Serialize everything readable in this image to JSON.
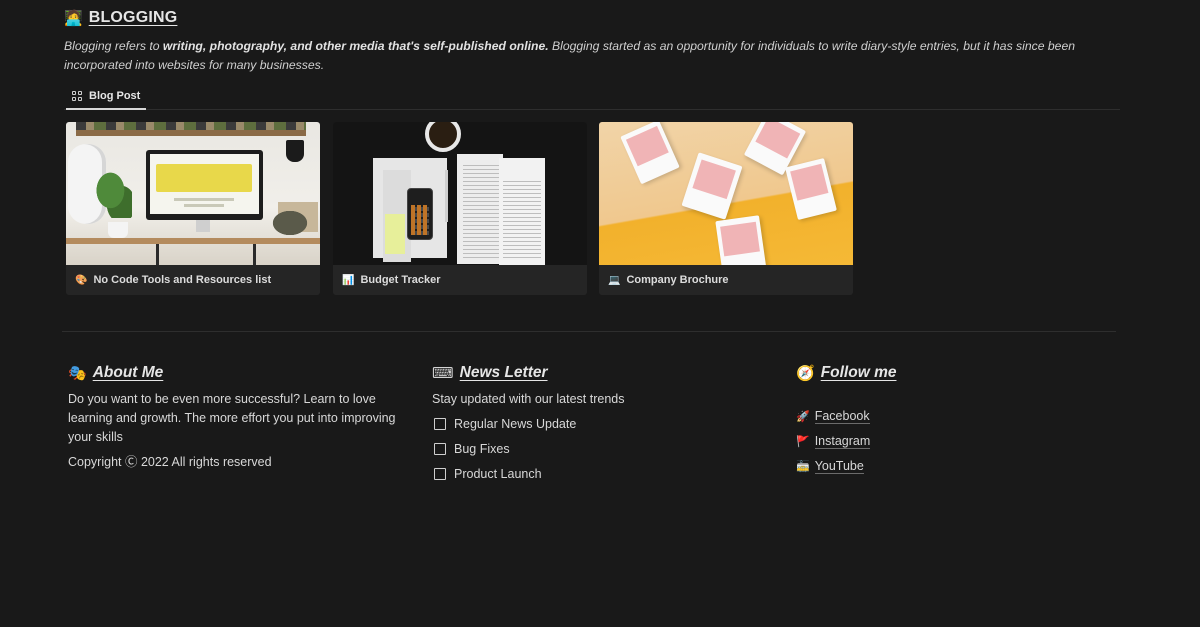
{
  "header": {
    "icon": "technologist-emoji-icon",
    "icon_glyph": "🧑‍💻",
    "title": "BLOGGING",
    "desc_pre": "Blogging refers to ",
    "desc_bold": "writing, photography, and other media that's self-published online.",
    "desc_post": " Blogging started as an opportunity for individuals to write diary-style entries, but it has since been incorporated into websites for many businesses."
  },
  "tabs": [
    {
      "label": "Blog Post",
      "icon": "gallery-grid-icon",
      "active": true
    }
  ],
  "cards": [
    {
      "title": "No Code Tools and Resources list",
      "icon": "palette-icon",
      "icon_glyph": "🎨",
      "image": "desk-with-monitor-and-plants"
    },
    {
      "title": "Budget Tracker",
      "icon": "bar-chart-icon",
      "icon_glyph": "📊",
      "image": "tax-forms-and-calculator"
    },
    {
      "title": "Company Brochure",
      "icon": "laptop-icon",
      "icon_glyph": "💻",
      "image": "floating-pink-brochures"
    }
  ],
  "about": {
    "icon": "performing-arts-icon",
    "icon_glyph": "🎭",
    "title": "About Me",
    "text": "Do you want to be even more successful? Learn to love learning and growth. The more effort you put into improving your skills",
    "copyright": "Copyright Ⓒ 2022 All rights reserved"
  },
  "newsletter": {
    "icon": "keyboard-icon",
    "icon_glyph": "⌨",
    "title": "News Letter",
    "subtitle": "Stay updated with our latest trends",
    "items": [
      {
        "label": "Regular News Update",
        "checked": false
      },
      {
        "label": "Bug Fixes",
        "checked": false
      },
      {
        "label": "Product Launch",
        "checked": false
      }
    ]
  },
  "follow": {
    "icon": "compass-icon",
    "icon_glyph": "🧭",
    "title": "Follow me",
    "links": [
      {
        "label": "Facebook",
        "icon": "rocket-icon",
        "icon_glyph": "🚀"
      },
      {
        "label": "Instagram",
        "icon": "triangular-flag-icon",
        "icon_glyph": "🚩"
      },
      {
        "label": "YouTube",
        "icon": "tram-icon",
        "icon_glyph": "🚋"
      }
    ]
  },
  "colors": {
    "background": "#191919",
    "card_background": "#252525",
    "text": "#d4d4d4",
    "divider": "#2e2e2e"
  }
}
